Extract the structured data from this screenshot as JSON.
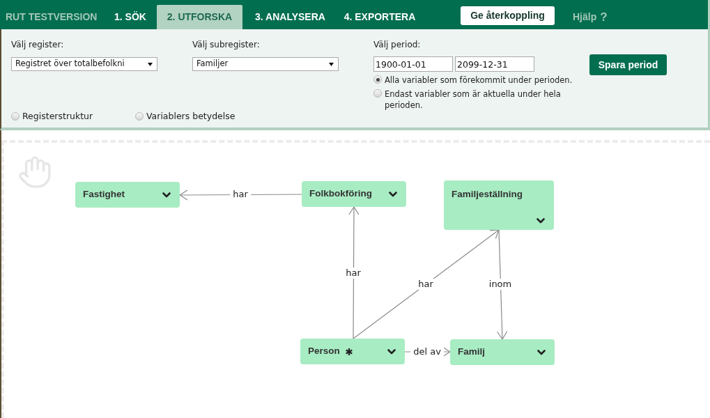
{
  "top_bar": {
    "brand": "RUT TESTVERSION",
    "tabs": [
      {
        "label": "1. SÖK",
        "selected": false
      },
      {
        "label": "2. UTFORSKA",
        "selected": true
      },
      {
        "label": "3. ANALYSERA",
        "selected": false
      },
      {
        "label": "4. EXPORTERA",
        "selected": false
      }
    ],
    "feedback_button": "Ge återkoppling",
    "help_link": {
      "label": "Hjälp",
      "symbol": "?"
    }
  },
  "selection_panel": {
    "register": {
      "label": "Välj register:",
      "value": "Registret över totalbefolkni"
    },
    "subregister": {
      "label": "Välj subregister:",
      "value": "Familjer"
    },
    "period": {
      "label": "Välj period:",
      "start": "1900-01-01",
      "end": "2099-12-31",
      "options": [
        {
          "label": "Alla variabler som förekommit under perioden.",
          "selected": true
        },
        {
          "label": "Endast variabler som är aktuella under hela perioden.",
          "selected": false
        }
      ],
      "save_button": "Spara period"
    },
    "views": [
      {
        "label": "Registerstruktur",
        "selected": false
      },
      {
        "label": "Variablers betydelse",
        "selected": false
      }
    ]
  },
  "diagram": {
    "nodes": [
      {
        "name": "Fastighet",
        "marked": false
      },
      {
        "name": "Folkbokföring",
        "marked": false
      },
      {
        "name": "Familjeställning",
        "marked": false
      },
      {
        "name": "Person",
        "marked": true
      },
      {
        "name": "Familj",
        "marked": false
      }
    ],
    "edges": [
      {
        "label": "har"
      },
      {
        "label": "har"
      },
      {
        "label": "har"
      },
      {
        "label": "inom"
      },
      {
        "label": "del av"
      }
    ]
  }
}
